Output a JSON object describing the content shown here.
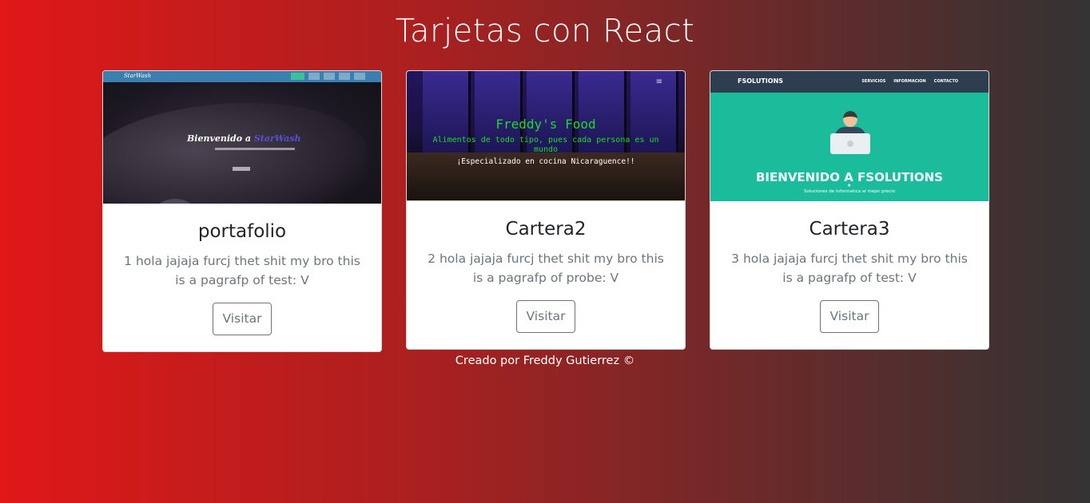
{
  "page": {
    "title": "Tarjetas con React",
    "footer": "Creado por Freddy Gutierrez ©"
  },
  "cards": [
    {
      "title": "portafolio",
      "text": "1 hola jajaja furcj thet shit my bro this is a pagrafp of test: V",
      "button": "Visitar",
      "thumbnail": {
        "hero_prefix": "Bienvenido a ",
        "hero_brand": "StarWash",
        "brand": "StarWash"
      }
    },
    {
      "title": "Cartera2",
      "text": "2 hola jajaja furcj thet shit my bro this is a pagrafp of probe: V",
      "button": "Visitar",
      "thumbnail": {
        "heading": "Freddy's Food",
        "line1": "Alimentos de todo tipo, pues cada persona es un mundo",
        "line2": "¡Especializado en cocina Nicaraguence!!",
        "menu_icon": "≡"
      }
    },
    {
      "title": "Cartera3",
      "text": "3 hola jajaja furcj thet shit my bro this is a pagrafp of test: V",
      "button": "Visitar",
      "thumbnail": {
        "brand": "FSOLUTIONS",
        "links": [
          "SERVICIOS",
          "INFORMACION",
          "CONTACTO"
        ],
        "heading": "BIENVENIDO A FSOLUTIONS",
        "tagline": "Soluciones de informatica al mejor precio"
      }
    }
  ],
  "colors": {
    "gradient_start": "#e01818",
    "gradient_end": "#333333",
    "food_green": "#1edb28",
    "fsolutions_teal": "#1abc9c",
    "fsolutions_nav": "#2c3e50"
  }
}
